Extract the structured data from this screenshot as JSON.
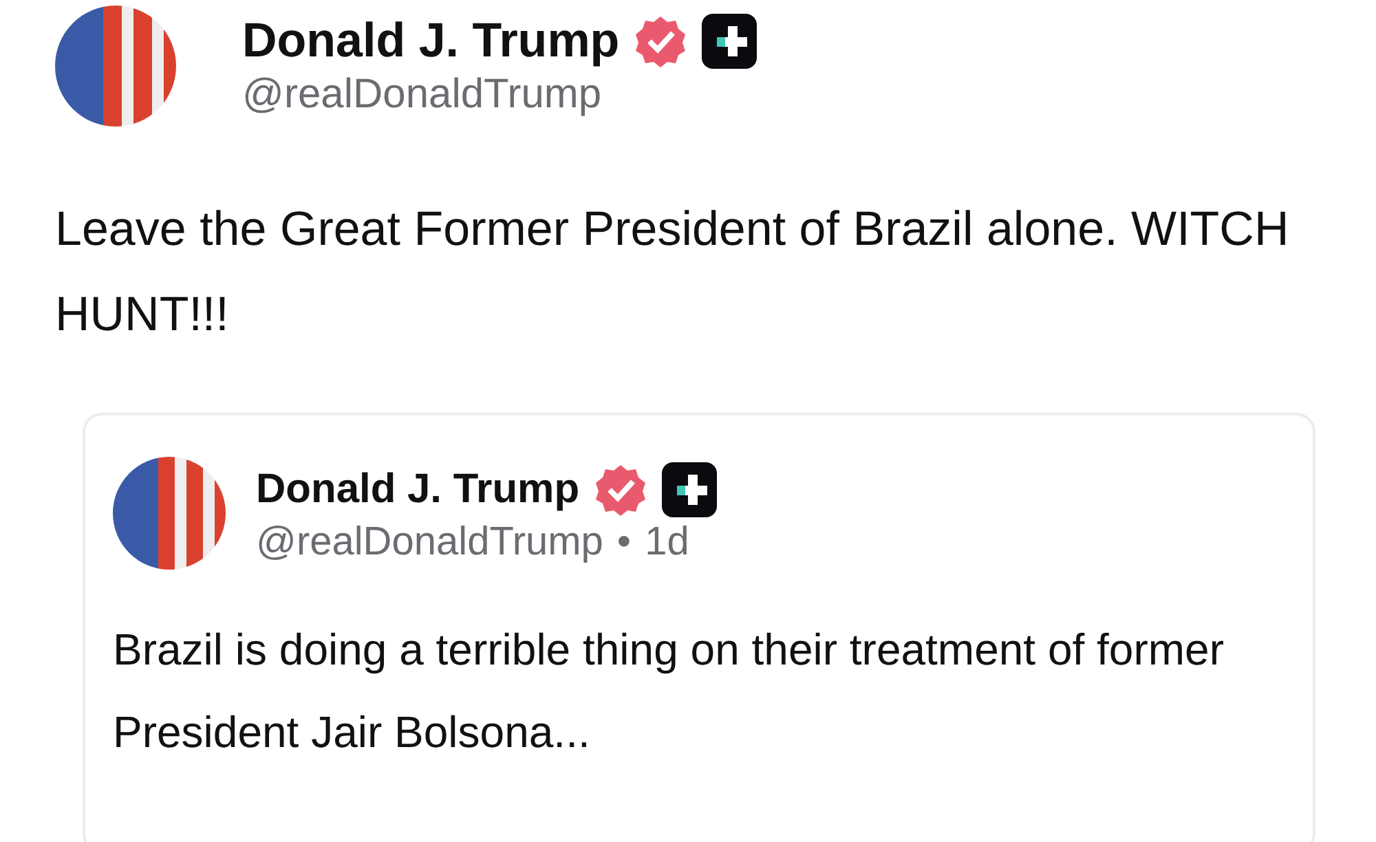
{
  "post": {
    "author": {
      "name": "Donald J. Trump",
      "verified": true,
      "handle": "@realDonaldTrump"
    },
    "text": "Leave the Great Former President of Brazil alone. WITCH HUNT!!!"
  },
  "quoted_post": {
    "author": {
      "name": "Donald J. Trump",
      "verified": true,
      "handle": "@realDonaldTrump"
    },
    "separator": "•",
    "time": "1d",
    "text": "Brazil is doing a terrible thing on their treatment of former President Jair Bolsona..."
  }
}
